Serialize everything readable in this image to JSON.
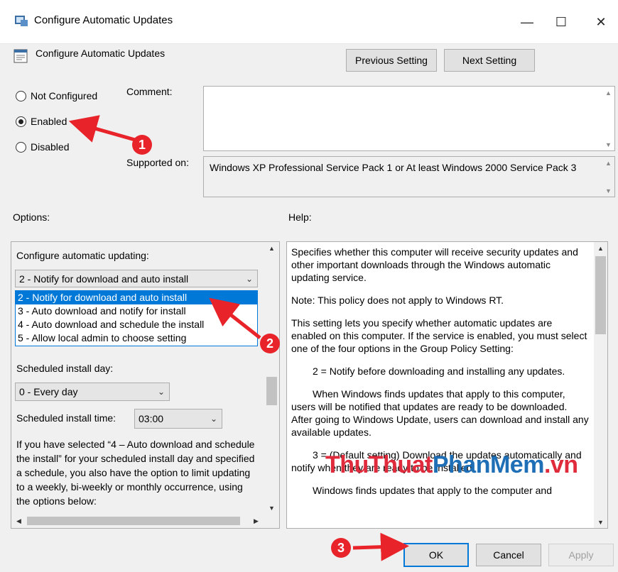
{
  "window": {
    "title": "Configure Automatic Updates",
    "minimize_glyph": "—",
    "maximize_glyph": "☐",
    "close_glyph": "✕"
  },
  "header": {
    "setting_name": "Configure Automatic Updates",
    "previous_label": "Previous Setting",
    "next_label": "Next Setting"
  },
  "state": {
    "not_configured_label": "Not Configured",
    "enabled_label": "Enabled",
    "disabled_label": "Disabled",
    "selected": "Enabled"
  },
  "comment": {
    "label": "Comment:",
    "value": ""
  },
  "supported": {
    "label": "Supported on:",
    "value": "Windows XP Professional Service Pack 1 or At least Windows 2000 Service Pack 3"
  },
  "options": {
    "heading": "Options:",
    "configure_label": "Configure automatic updating:",
    "configure_selected": "2 - Notify for download and auto install",
    "configure_options": [
      "2 - Notify for download and auto install",
      "3 - Auto download and notify for install",
      "4 - Auto download and schedule the install",
      "5 - Allow local admin to choose setting"
    ],
    "install_day_label": "Scheduled install day:",
    "install_day_value": "0 - Every day",
    "install_time_label": "Scheduled install time:",
    "install_time_value": "03:00",
    "note": "If you have selected “4 – Auto download and schedule the install” for your scheduled install day and specified a schedule, you also have the option to limit updating to a weekly, bi-weekly or monthly occurrence, using the options below:"
  },
  "help": {
    "heading": "Help:",
    "paragraphs": [
      "Specifies whether this computer will receive security updates and other important downloads through the Windows automatic updating service.",
      "Note: This policy does not apply to Windows RT.",
      "This setting lets you specify whether automatic updates are enabled on this computer. If the service is enabled, you must select one of the four options in the Group Policy Setting:",
      "2 = Notify before downloading and installing any updates.",
      "When Windows finds updates that apply to this computer, users will be notified that updates are ready to be downloaded. After going to Windows Update, users can download and install any available updates.",
      "3 = (Default setting) Download the updates automatically and notify when they are ready to be installed",
      "Windows finds updates that apply to the computer and"
    ]
  },
  "footer": {
    "ok_label": "OK",
    "cancel_label": "Cancel",
    "apply_label": "Apply"
  },
  "annotations": {
    "marker_1": "1",
    "marker_2": "2",
    "marker_3": "3",
    "arrow_color": "#e8232a"
  },
  "watermark": {
    "part1": "ThuThuat",
    "part2": "PhanMem",
    "part3": ".vn"
  },
  "colors": {
    "accent": "#0078d7",
    "dialog_bg": "#f0f0f0",
    "marker_red": "#e8232a"
  }
}
